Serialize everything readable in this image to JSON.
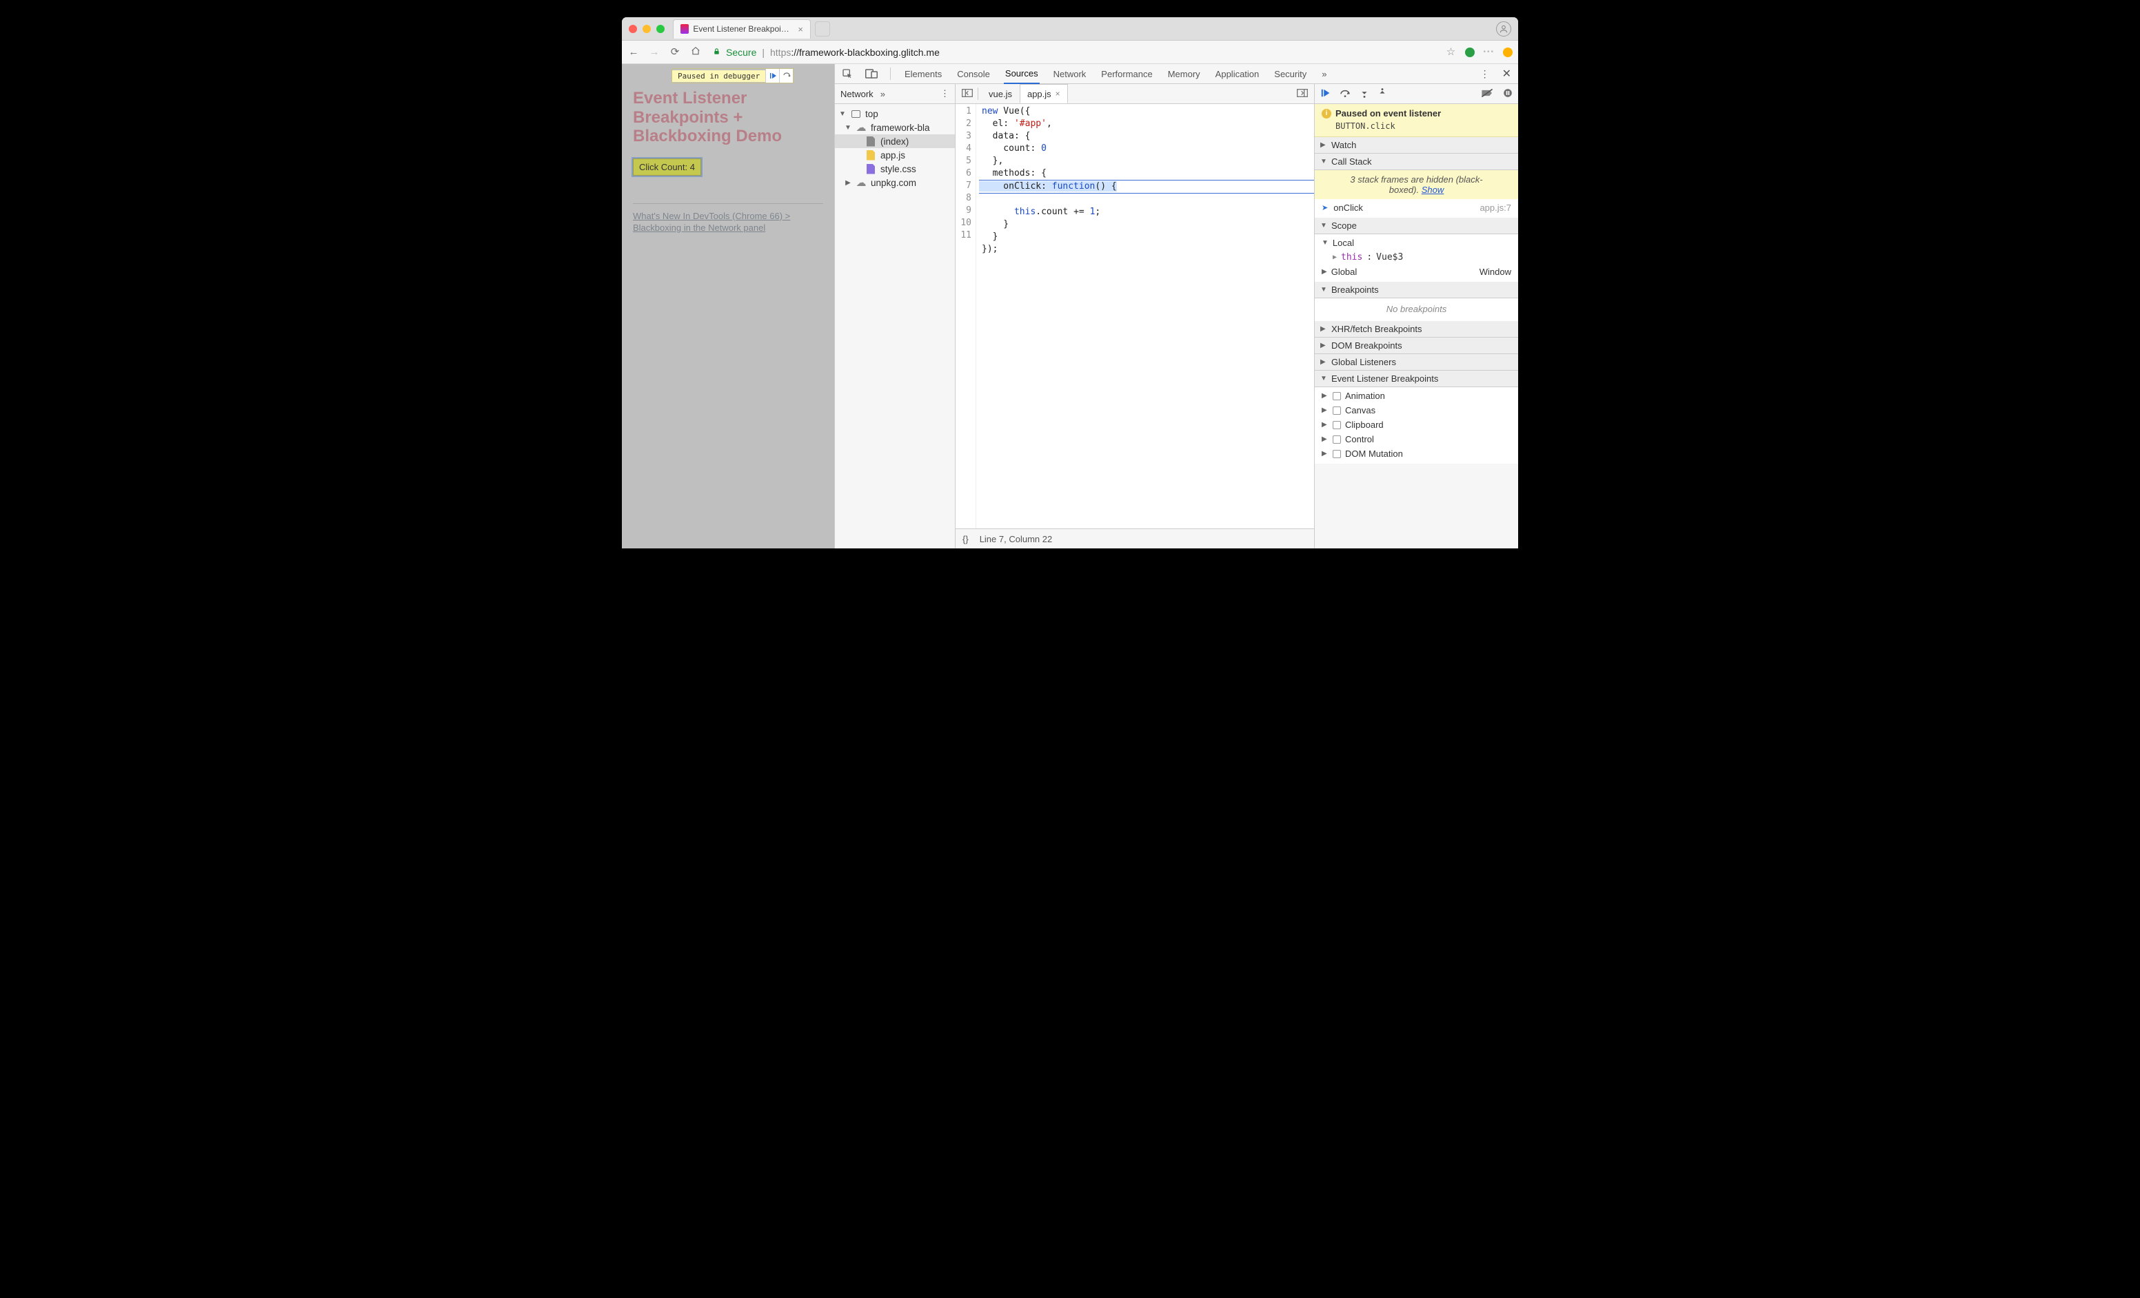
{
  "tab": {
    "title": "Event Listener Breakpoints + B"
  },
  "toolbar": {
    "secure_label": "Secure",
    "url_scheme": "https",
    "url_host": "://framework-blackboxing.glitch.me"
  },
  "page": {
    "pause_overlay": "Paused in debugger",
    "heading": "Event Listener Breakpoints + Blackboxing Demo",
    "button_label": "Click Count: 4",
    "link_text": "What's New In DevTools (Chrome 66) > Blackboxing in the Network panel"
  },
  "devtools": {
    "tabs": [
      "Elements",
      "Console",
      "Sources",
      "Network",
      "Performance",
      "Memory",
      "Application",
      "Security"
    ],
    "active_tab": "Sources",
    "overflow": "»"
  },
  "navigator": {
    "tab_label": "Network",
    "top": "top",
    "domain_primary": "framework-bla",
    "files": [
      "(index)",
      "app.js",
      "style.css"
    ],
    "domain_secondary": "unpkg.com"
  },
  "editor": {
    "tabs": [
      "vue.js",
      "app.js"
    ],
    "active": "app.js",
    "code_lines": [
      "new Vue({",
      "  el: '#app',",
      "  data: {",
      "    count: 0",
      "  },",
      "  methods: {",
      "    onClick: function() {",
      "      this.count += 1;",
      "    }",
      "  }",
      "});"
    ],
    "current_line": 7,
    "status_braces": "{}",
    "status_loc": "Line 7, Column 22"
  },
  "debugger": {
    "banner_title": "Paused on event listener",
    "banner_code": "BUTTON.click",
    "sections": {
      "watch": "Watch",
      "callstack": "Call Stack",
      "scope": "Scope",
      "breakpoints": "Breakpoints",
      "xhr": "XHR/fetch Breakpoints",
      "dom": "DOM Breakpoints",
      "global": "Global Listeners",
      "elb": "Event Listener Breakpoints"
    },
    "callstack": {
      "hidden_msg_a": "3 stack frames are hidden (black-",
      "hidden_msg_b": "boxed). ",
      "hidden_show": "Show",
      "frame_name": "onClick",
      "frame_loc": "app.js:7"
    },
    "scope": {
      "local_label": "Local",
      "this_key": "this",
      "this_val": "Vue$3",
      "global_label": "Global",
      "global_val": "Window"
    },
    "no_breakpoints": "No breakpoints",
    "elb_categories": [
      "Animation",
      "Canvas",
      "Clipboard",
      "Control",
      "DOM Mutation"
    ]
  }
}
